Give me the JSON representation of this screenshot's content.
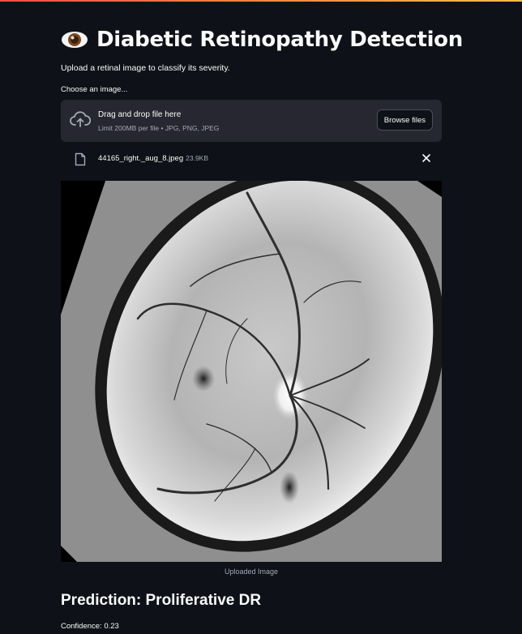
{
  "header": {
    "icon": "eye-icon",
    "title": "Diabetic Retinopathy Detection",
    "subtitle": "Upload a retinal image to classify its severity."
  },
  "uploader": {
    "label": "Choose an image...",
    "drop_title": "Drag and drop file here",
    "drop_subtitle": "Limit 200MB per file • JPG, PNG, JPEG",
    "browse_label": "Browse files",
    "upload_icon": "cloud-upload-icon"
  },
  "file": {
    "name": "44165_right._aug_8.jpeg",
    "size": "23.9KB",
    "icon": "file-icon",
    "remove_icon": "close-icon"
  },
  "image": {
    "caption": "Uploaded Image"
  },
  "result": {
    "prediction": "Prediction: Proliferative DR",
    "confidence": "Confidence: 0.23"
  },
  "colors": {
    "background": "#0e1117",
    "panel": "#262730",
    "text": "#fafafa",
    "muted": "#a3a8b8",
    "accent": "#ff4b4b"
  }
}
